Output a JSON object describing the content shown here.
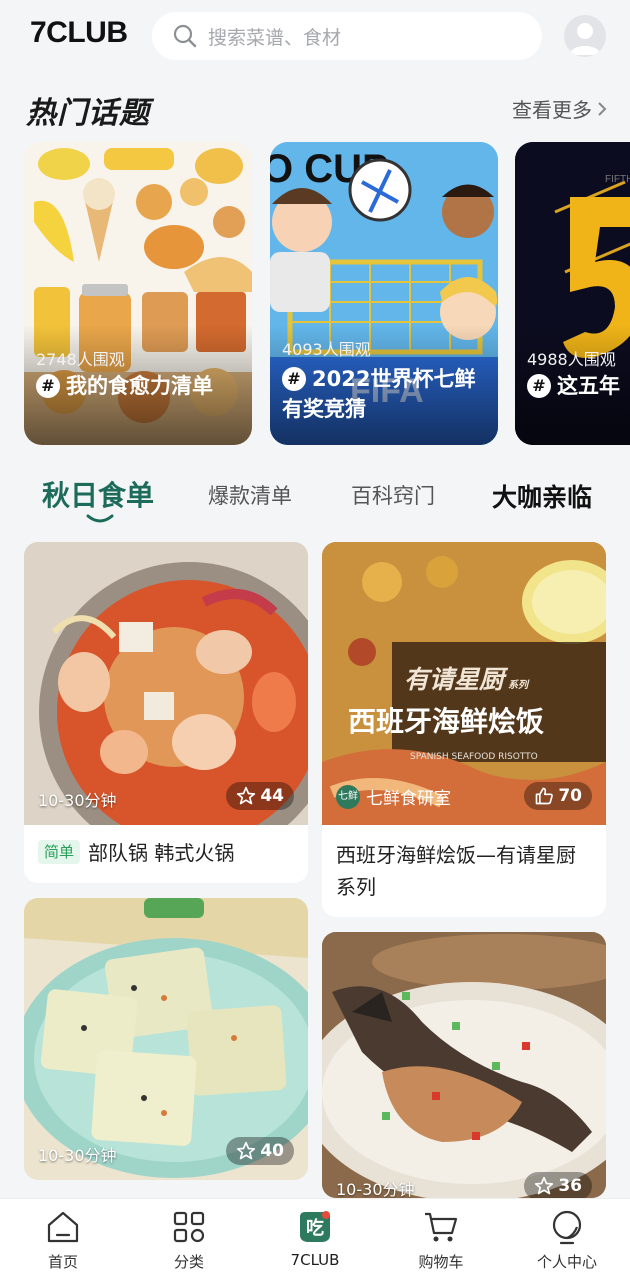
{
  "header": {
    "logo": "7CLUB",
    "search_placeholder": "搜索菜谱、食材"
  },
  "hot_topics": {
    "title": "热门话题",
    "see_more": "查看更多",
    "items": [
      {
        "viewers": "2748人围观",
        "title": "我的食愈力清单"
      },
      {
        "viewers": "4093人围观",
        "title": "2022世界杯七鲜有奖竞猜"
      },
      {
        "viewers": "4988人围观",
        "title": "这五年"
      }
    ]
  },
  "tabs": {
    "items": [
      "秋日食单",
      "爆款清单",
      "百科窍门"
    ],
    "brand": "大咖亲临",
    "active": "秋日食单"
  },
  "feed": {
    "cards": [
      {
        "time": "10-30分钟",
        "likes": "44",
        "tag": "简单",
        "title": "部队锅  韩式火锅"
      },
      {
        "source": "七鲜食研室",
        "source_badge": "七鲜",
        "likes": "70",
        "title": "西班牙海鲜烩饭—有请星厨系列",
        "overlay_top": "有请星厨",
        "overlay_series": "系列",
        "overlay_title": "西班牙海鲜烩饭",
        "overlay_sub": "SPANISH SEAFOOD RISOTTO"
      },
      {
        "time": "10-30分钟",
        "likes": "40"
      },
      {
        "time": "10-30分钟",
        "likes": "36"
      }
    ]
  },
  "bottom_nav": {
    "items": [
      "首页",
      "分类",
      "7CLUB",
      "购物车",
      "个人中心"
    ],
    "active": "7CLUB",
    "center_glyph": "吃"
  },
  "colors": {
    "accent": "#1d6b5a",
    "tag_green": "#29a05a",
    "background": "#f4f5f7"
  }
}
